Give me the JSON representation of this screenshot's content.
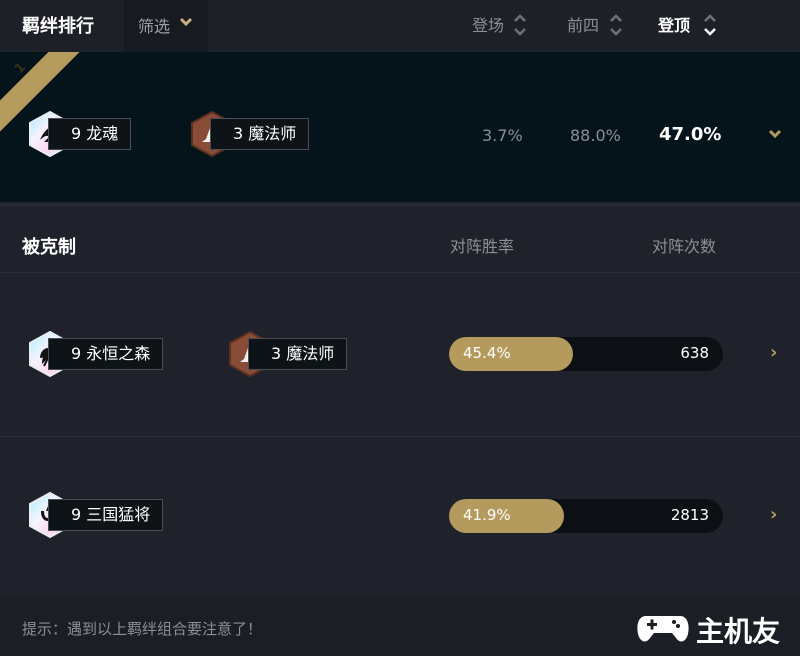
{
  "header": {
    "title": "羁绊排行",
    "filter_label": "筛选",
    "sort": [
      {
        "label": "登场",
        "active": false
      },
      {
        "label": "前四",
        "active": false
      },
      {
        "label": "登顶",
        "active": true
      }
    ]
  },
  "top_comp": {
    "rank": "1",
    "traits": [
      {
        "label": "9 龙魂",
        "icon": "dragon-soul-icon",
        "tier": "prismatic"
      },
      {
        "label": "3 魔法师",
        "icon": "mage-hat-icon",
        "tier": "bronze"
      }
    ],
    "play_rate": "3.7%",
    "top4_rate": "88.0%",
    "win_rate": "47.0%"
  },
  "counters": {
    "title": "被克制",
    "col_winrate": "对阵胜率",
    "col_count": "对阵次数",
    "rows": [
      {
        "traits": [
          {
            "label": "9 永恒之森",
            "icon": "leaf-icon",
            "tier": "prismatic"
          },
          {
            "label": "3 魔法师",
            "icon": "mage-hat-icon",
            "tier": "bronze"
          }
        ],
        "winrate_text": "45.4%",
        "winrate": 0.454,
        "count": "638"
      },
      {
        "traits": [
          {
            "label": "9 三国猛将",
            "icon": "trident-icon",
            "tier": "prismatic"
          }
        ],
        "winrate_text": "41.9%",
        "winrate": 0.419,
        "count": "2813"
      }
    ]
  },
  "footer": {
    "tip": "提示：遇到以上羁绊组合要注意了！",
    "watermark": "主机友"
  },
  "colors": {
    "accent_gold": "#b49a5c",
    "bronze": "#8a4b37"
  }
}
